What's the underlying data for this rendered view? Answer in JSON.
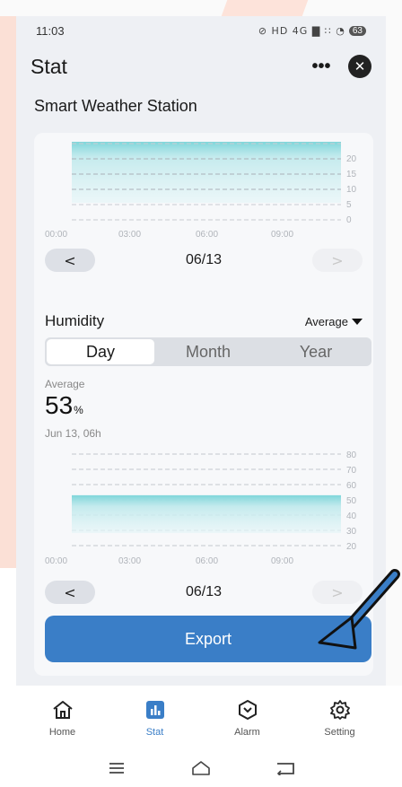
{
  "status_bar": {
    "time": "11:03",
    "icons": "⊘ HD 4G ▇ ∷ ◔",
    "battery": "63"
  },
  "header": {
    "title": "Stat",
    "more_label": "•••",
    "close_label": "✕"
  },
  "device": {
    "name": "Smart Weather Station"
  },
  "top_chart": {
    "y_ticks": [
      "20",
      "15",
      "10",
      "5",
      "0"
    ],
    "x_ticks": [
      "00:00",
      "03:00",
      "06:00",
      "09:00"
    ]
  },
  "top_nav": {
    "prev": "<",
    "date": "06/13",
    "next": ">"
  },
  "humidity": {
    "title": "Humidity",
    "aggregation": "Average",
    "tabs": [
      "Day",
      "Month",
      "Year"
    ],
    "active_tab": "Day",
    "caption": "Average",
    "value": "53",
    "unit": "%",
    "timestamp": "Jun 13, 06h"
  },
  "chart_data": {
    "type": "area",
    "x": [
      "00:00",
      "03:00",
      "06:00",
      "09:00",
      "11:00"
    ],
    "ylim": [
      20,
      80
    ],
    "y_ticks": [
      "80",
      "70",
      "60",
      "50",
      "40",
      "30",
      "20"
    ],
    "x_ticks": [
      "00:00",
      "03:00",
      "06:00",
      "09:00"
    ],
    "series": [
      {
        "values": [
          53,
          53,
          53,
          53,
          53
        ],
        "color": "#7fd6da"
      }
    ],
    "grid": true
  },
  "bottom_nav": {
    "prev": "<",
    "date": "06/13",
    "next": ">"
  },
  "export_label": "Export",
  "tabbar": {
    "items": [
      {
        "label": "Home",
        "icon": "home-icon",
        "active": false
      },
      {
        "label": "Stat",
        "icon": "bar-chart-icon",
        "active": true
      },
      {
        "label": "Alarm",
        "icon": "alarm-icon",
        "active": false
      },
      {
        "label": "Setting",
        "icon": "gear-icon",
        "active": false
      }
    ]
  },
  "colors": {
    "accent": "#3a7ec7",
    "area": "#7fd6da"
  }
}
